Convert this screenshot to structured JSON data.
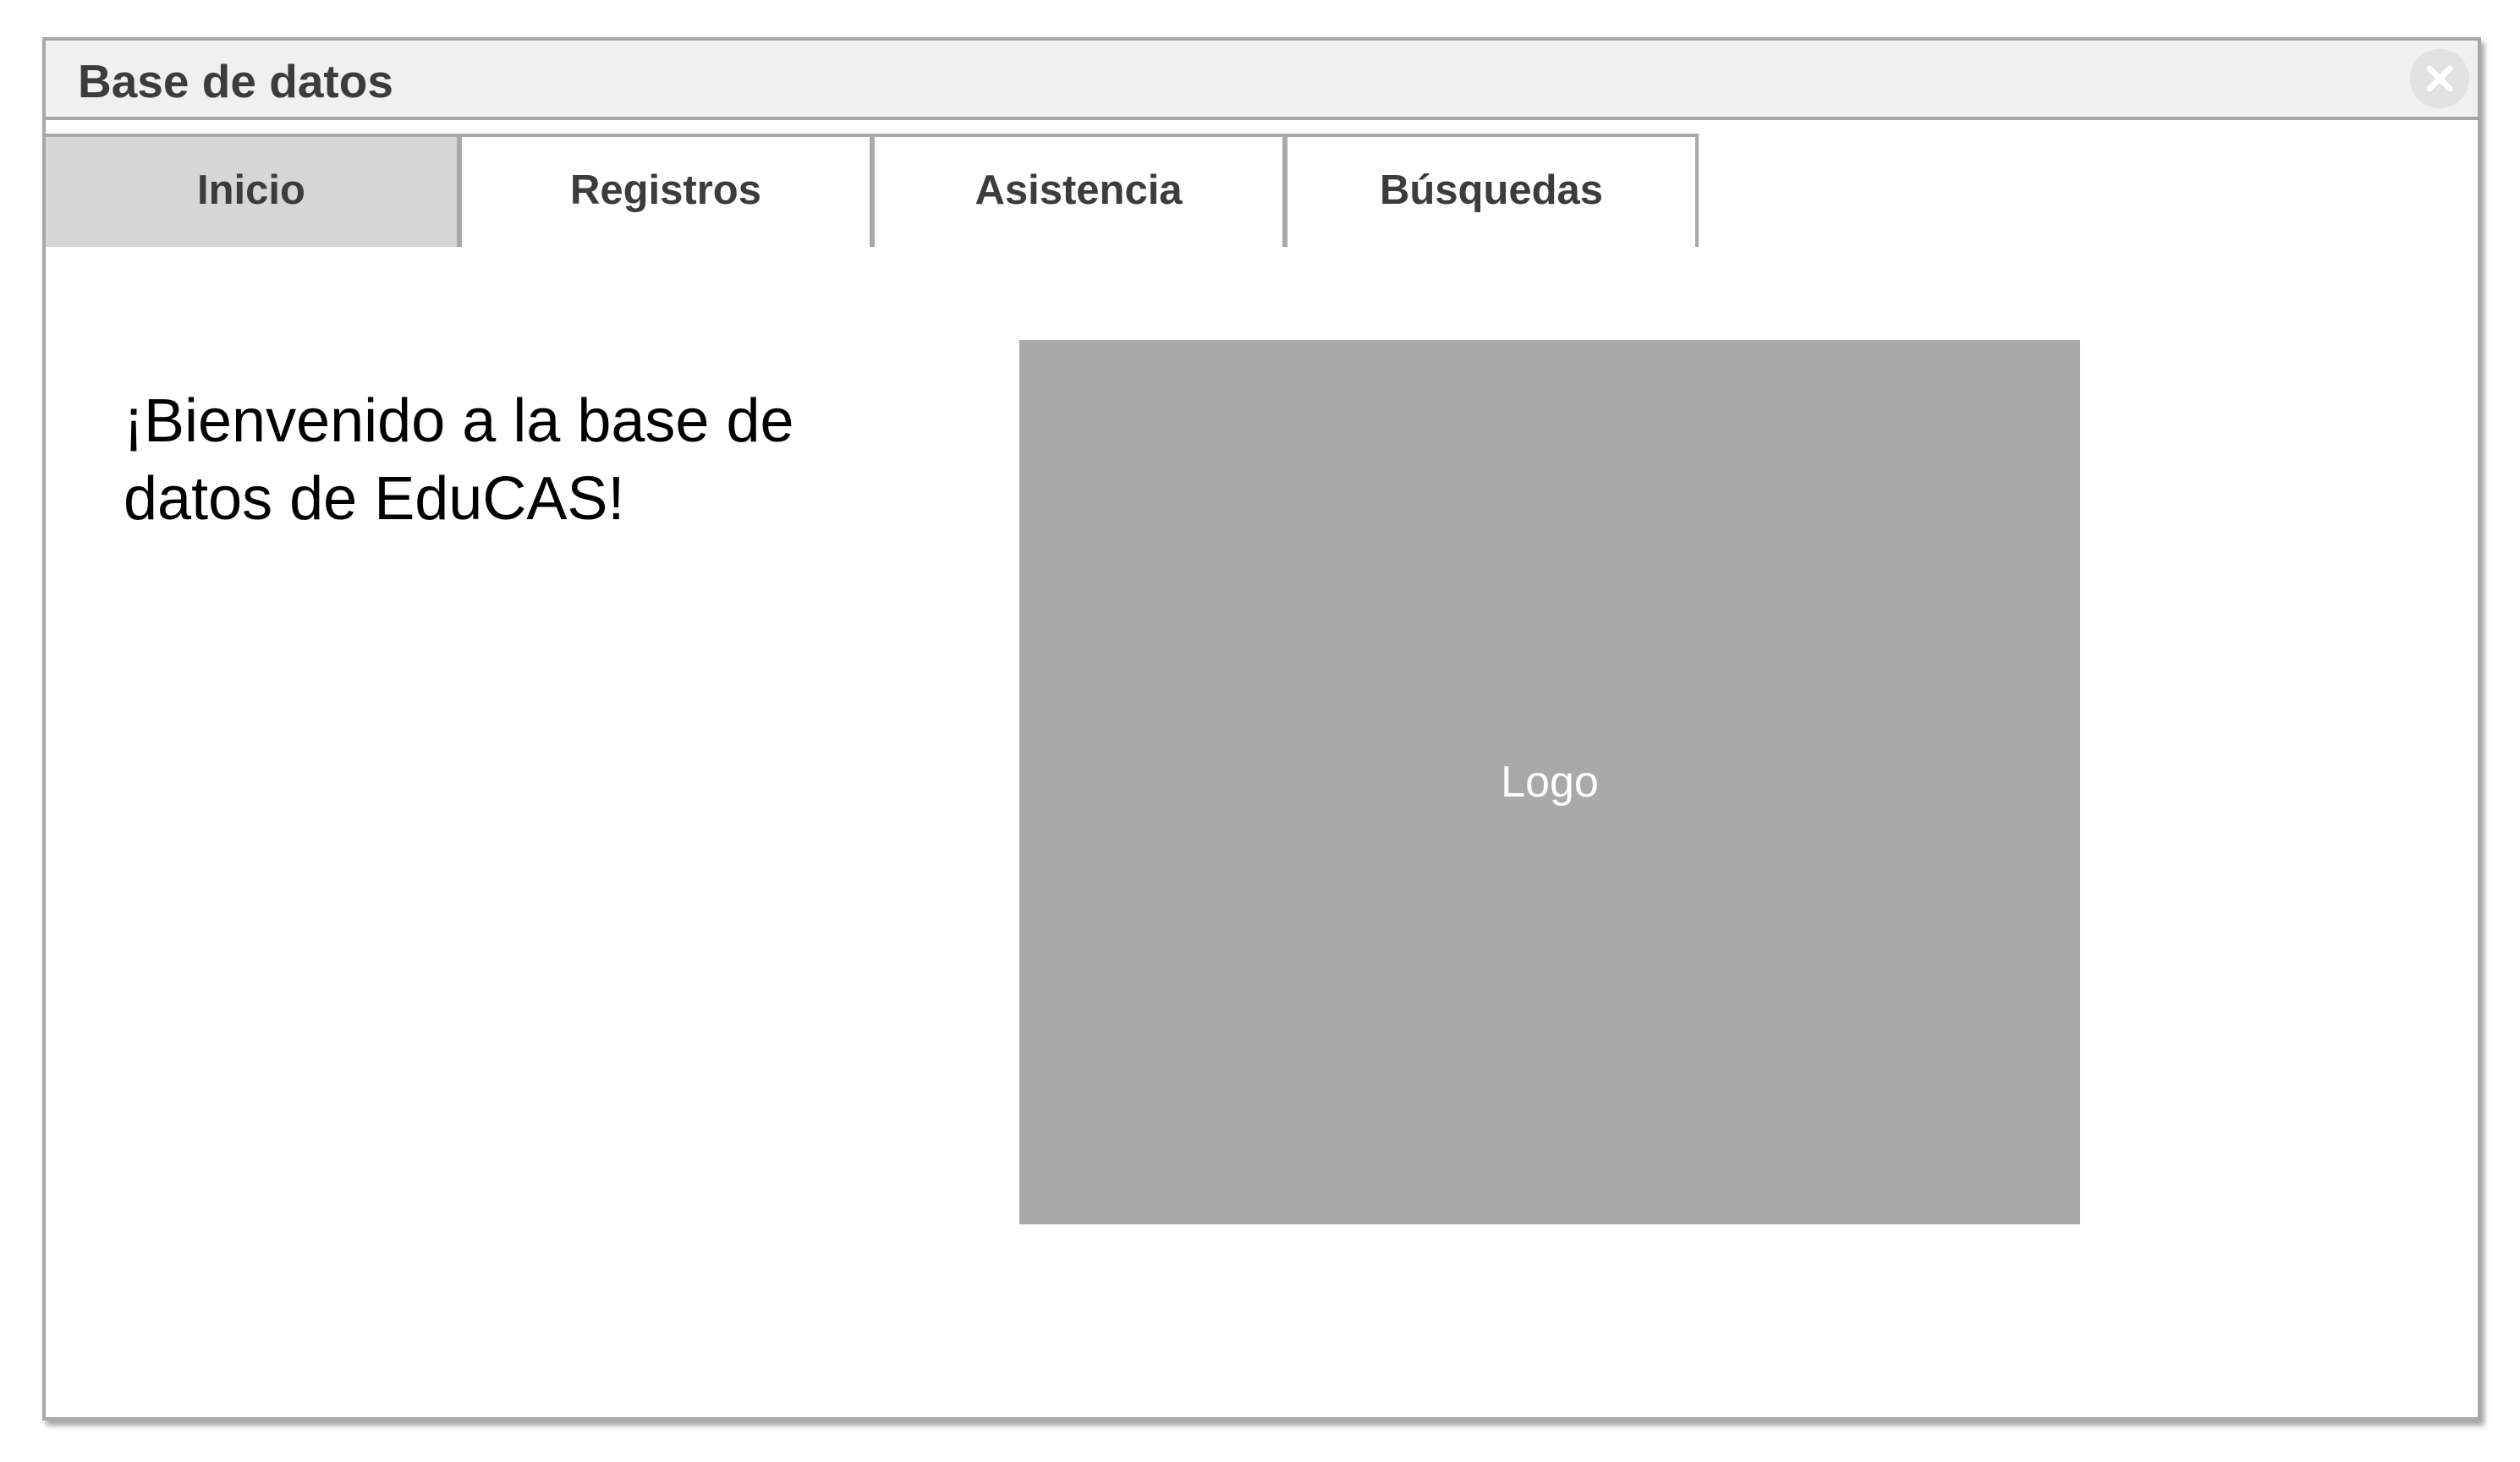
{
  "window": {
    "title": "Base de datos",
    "close_icon": "close-icon"
  },
  "tabs": [
    {
      "label": "Inicio",
      "active": true
    },
    {
      "label": "Registros",
      "active": false
    },
    {
      "label": "Asistencia",
      "active": false
    },
    {
      "label": "Búsquedas",
      "active": false
    }
  ],
  "main": {
    "welcome_text": "¡Bienvenido a la base de datos de EduCAS!",
    "logo_placeholder": "Logo"
  },
  "colors": {
    "title_bar": "#f0f0f0",
    "border": "#a8a8a8",
    "active_tab": "#d6d6d6",
    "logo_placeholder": "#a9a9a9"
  }
}
